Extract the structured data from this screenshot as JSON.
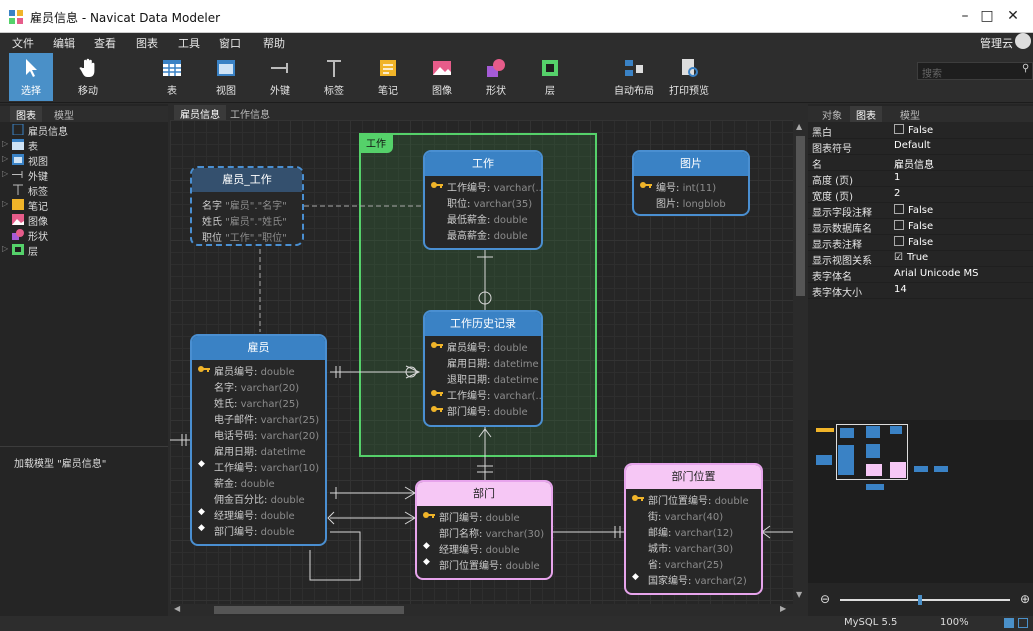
{
  "window": {
    "title": "雇员信息 - Navicat Data Modeler",
    "min": "–",
    "max": "□",
    "close": "✕"
  },
  "menu": [
    "文件",
    "编辑",
    "查看",
    "图表",
    "工具",
    "窗口",
    "帮助"
  ],
  "user": "管理云",
  "toolbar": [
    "选择",
    "移动",
    "表",
    "视图",
    "外键",
    "标签",
    "笔记",
    "图像",
    "形状",
    "层",
    "自动布局",
    "打印预览"
  ],
  "search_placeholder": "搜索",
  "left_tabs": [
    "图表",
    "模型"
  ],
  "tree": [
    "雇员信息",
    "表",
    "视图",
    "外键",
    "标签",
    "笔记",
    "图像",
    "形状",
    "层"
  ],
  "left_status": "加载模型 \"雇员信息\"",
  "doc_tabs": [
    "雇员信息",
    "工作信息"
  ],
  "layer_label": "工作",
  "entities": {
    "employee_job": {
      "name": "雇员_工作",
      "fields": [
        [
          "名字",
          "\"雇员\".\"名字\""
        ],
        [
          "姓氏",
          "\"雇员\".\"姓氏\""
        ],
        [
          "职位",
          "\"工作\".\"职位\""
        ]
      ]
    },
    "job": {
      "name": "工作",
      "fields": [
        [
          "工作编号",
          "varchar(..."
        ],
        [
          "职位",
          "varchar(35)"
        ],
        [
          "最低薪金",
          "double"
        ],
        [
          "最高薪金",
          "double"
        ]
      ]
    },
    "picture": {
      "name": "图片",
      "fields": [
        [
          "编号",
          "int(11)"
        ],
        [
          "图片",
          "longblob"
        ]
      ]
    },
    "job_history": {
      "name": "工作历史记录",
      "fields": [
        [
          "雇员编号",
          "double"
        ],
        [
          "雇用日期",
          "datetime"
        ],
        [
          "退职日期",
          "datetime"
        ],
        [
          "工作编号",
          "varchar(..."
        ],
        [
          "部门编号",
          "double"
        ]
      ]
    },
    "employee": {
      "name": "雇员",
      "fields": [
        [
          "雇员编号",
          "double"
        ],
        [
          "名字",
          "varchar(20)"
        ],
        [
          "姓氏",
          "varchar(25)"
        ],
        [
          "电子邮件",
          "varchar(25)"
        ],
        [
          "电话号码",
          "varchar(20)"
        ],
        [
          "雇用日期",
          "datetime"
        ],
        [
          "工作编号",
          "varchar(10)"
        ],
        [
          "薪金",
          "double"
        ],
        [
          "佣金百分比",
          "double"
        ],
        [
          "经理编号",
          "double"
        ],
        [
          "部门编号",
          "double"
        ]
      ]
    },
    "department": {
      "name": "部门",
      "fields": [
        [
          "部门编号",
          "double"
        ],
        [
          "部门名称",
          "varchar(30)"
        ],
        [
          "经理编号",
          "double"
        ],
        [
          "部门位置编号",
          "double"
        ]
      ]
    },
    "location": {
      "name": "部门位置",
      "fields": [
        [
          "部门位置编号",
          "double"
        ],
        [
          "街",
          "varchar(40)"
        ],
        [
          "邮编",
          "varchar(12)"
        ],
        [
          "城市",
          "varchar(30)"
        ],
        [
          "省",
          "varchar(25)"
        ],
        [
          "国家编号",
          "varchar(2)"
        ]
      ]
    }
  },
  "right_tabs": [
    "对象",
    "图表",
    "模型"
  ],
  "props": [
    [
      "黑白",
      "False"
    ],
    [
      "图表符号",
      "Default"
    ],
    [
      "名",
      "雇员信息"
    ],
    [
      "高度 (页)",
      "1"
    ],
    [
      "宽度 (页)",
      "2"
    ],
    [
      "显示字段注释",
      "False"
    ],
    [
      "显示数据库名",
      "False"
    ],
    [
      "显示表注释",
      "False"
    ],
    [
      "显示视图关系",
      "True"
    ],
    [
      "表字体名",
      "Arial Unicode MS"
    ],
    [
      "表字体大小",
      "14"
    ]
  ],
  "status": {
    "db": "MySQL 5.5",
    "zoom": "100%"
  },
  "colors": {
    "accent": "#3a82c5",
    "layer": "#55d16a",
    "pink": "#f6c7f5"
  }
}
